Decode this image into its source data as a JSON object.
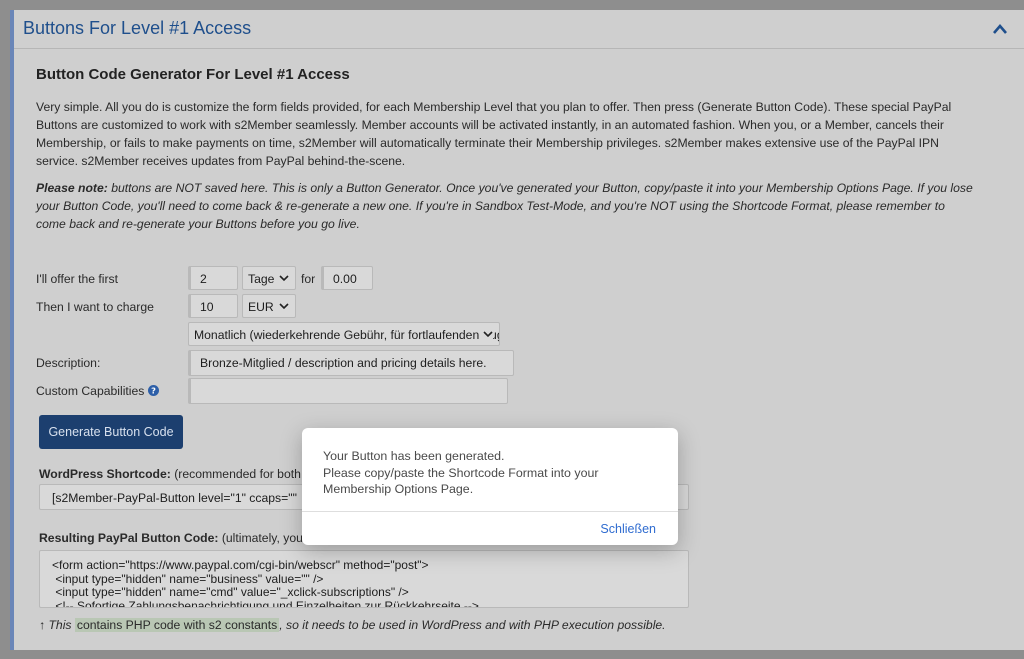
{
  "panel": {
    "title": "Buttons For Level #1 Access",
    "collapse_icon": "chevron-up-icon"
  },
  "content": {
    "heading": "Button Code Generator For Level #1 Access",
    "intro": "Very simple. All you do is customize the form fields provided, for each Membership Level that you plan to offer. Then press (Generate Button Code). These special PayPal Buttons are customized to work with s2Member seamlessly. Member accounts will be activated instantly, in an automated fashion. When you, or a Member, cancels their Membership, or fails to make payments on time, s2Member will automatically terminate their Membership privileges. s2Member makes extensive use of the PayPal IPN service. s2Member receives updates from PayPal behind-the-scene.",
    "note_bold": "Please note:",
    "note_text": " buttons are NOT saved here. This is only a Button Generator. Once you've generated your Button, copy/paste it into your Membership Options Page. If you lose your Button Code, you'll need to come back & re-generate a new one. If you're in Sandbox Test-Mode, and you're NOT using the Shortcode Format, please remember to come back and re-generate your Buttons before you go live."
  },
  "form": {
    "offer_label": "I'll offer the first",
    "offer_period": "2",
    "offer_unit": "Tage",
    "for_label": "for",
    "offer_price": "0.00",
    "charge_label": "Then I want to charge",
    "charge_amount": "10",
    "currency": "EUR",
    "recurrence": "Monatlich (wiederkehrende Gebühr, für fortlaufenden Zugang)",
    "description_label": "Description:",
    "description_value": "Bronze-Mitglied / description and pricing details here.",
    "capabilities_label": "Custom Capabilities",
    "capabilities_value": "",
    "help_icon": "question-circle-icon",
    "generate_button": "Generate Button Code"
  },
  "shortcode": {
    "label_bold": "WordPress Shortcode:",
    "label_text": " (recommended for both",
    "value": "[s2Member-PayPal-Button level=\"1\" ccaps=\"\""
  },
  "code": {
    "label_bold": "Resulting PayPal Button Code:",
    "label_text": " (ultimately, your",
    "value": "<form action=\"https://www.paypal.com/cgi-bin/webscr\" method=\"post\">\n <input type=\"hidden\" name=\"business\" value=\"\" />\n <input type=\"hidden\" name=\"cmd\" value=\"_xclick-subscriptions\" />\n <!-- Sofortige Zahlungsbenachrichtigung und Einzelheiten zur Rückkehrseite -->",
    "foot_pre": "↑ This ",
    "foot_hl": "contains PHP code with s2 constants",
    "foot_post": ", so it needs to be used in WordPress and with PHP execution possible."
  },
  "dialog": {
    "line1": "Your Button has been generated.",
    "line2": "Please copy/paste the Shortcode Format into your Membership Options Page.",
    "close_button": "Schließen"
  }
}
